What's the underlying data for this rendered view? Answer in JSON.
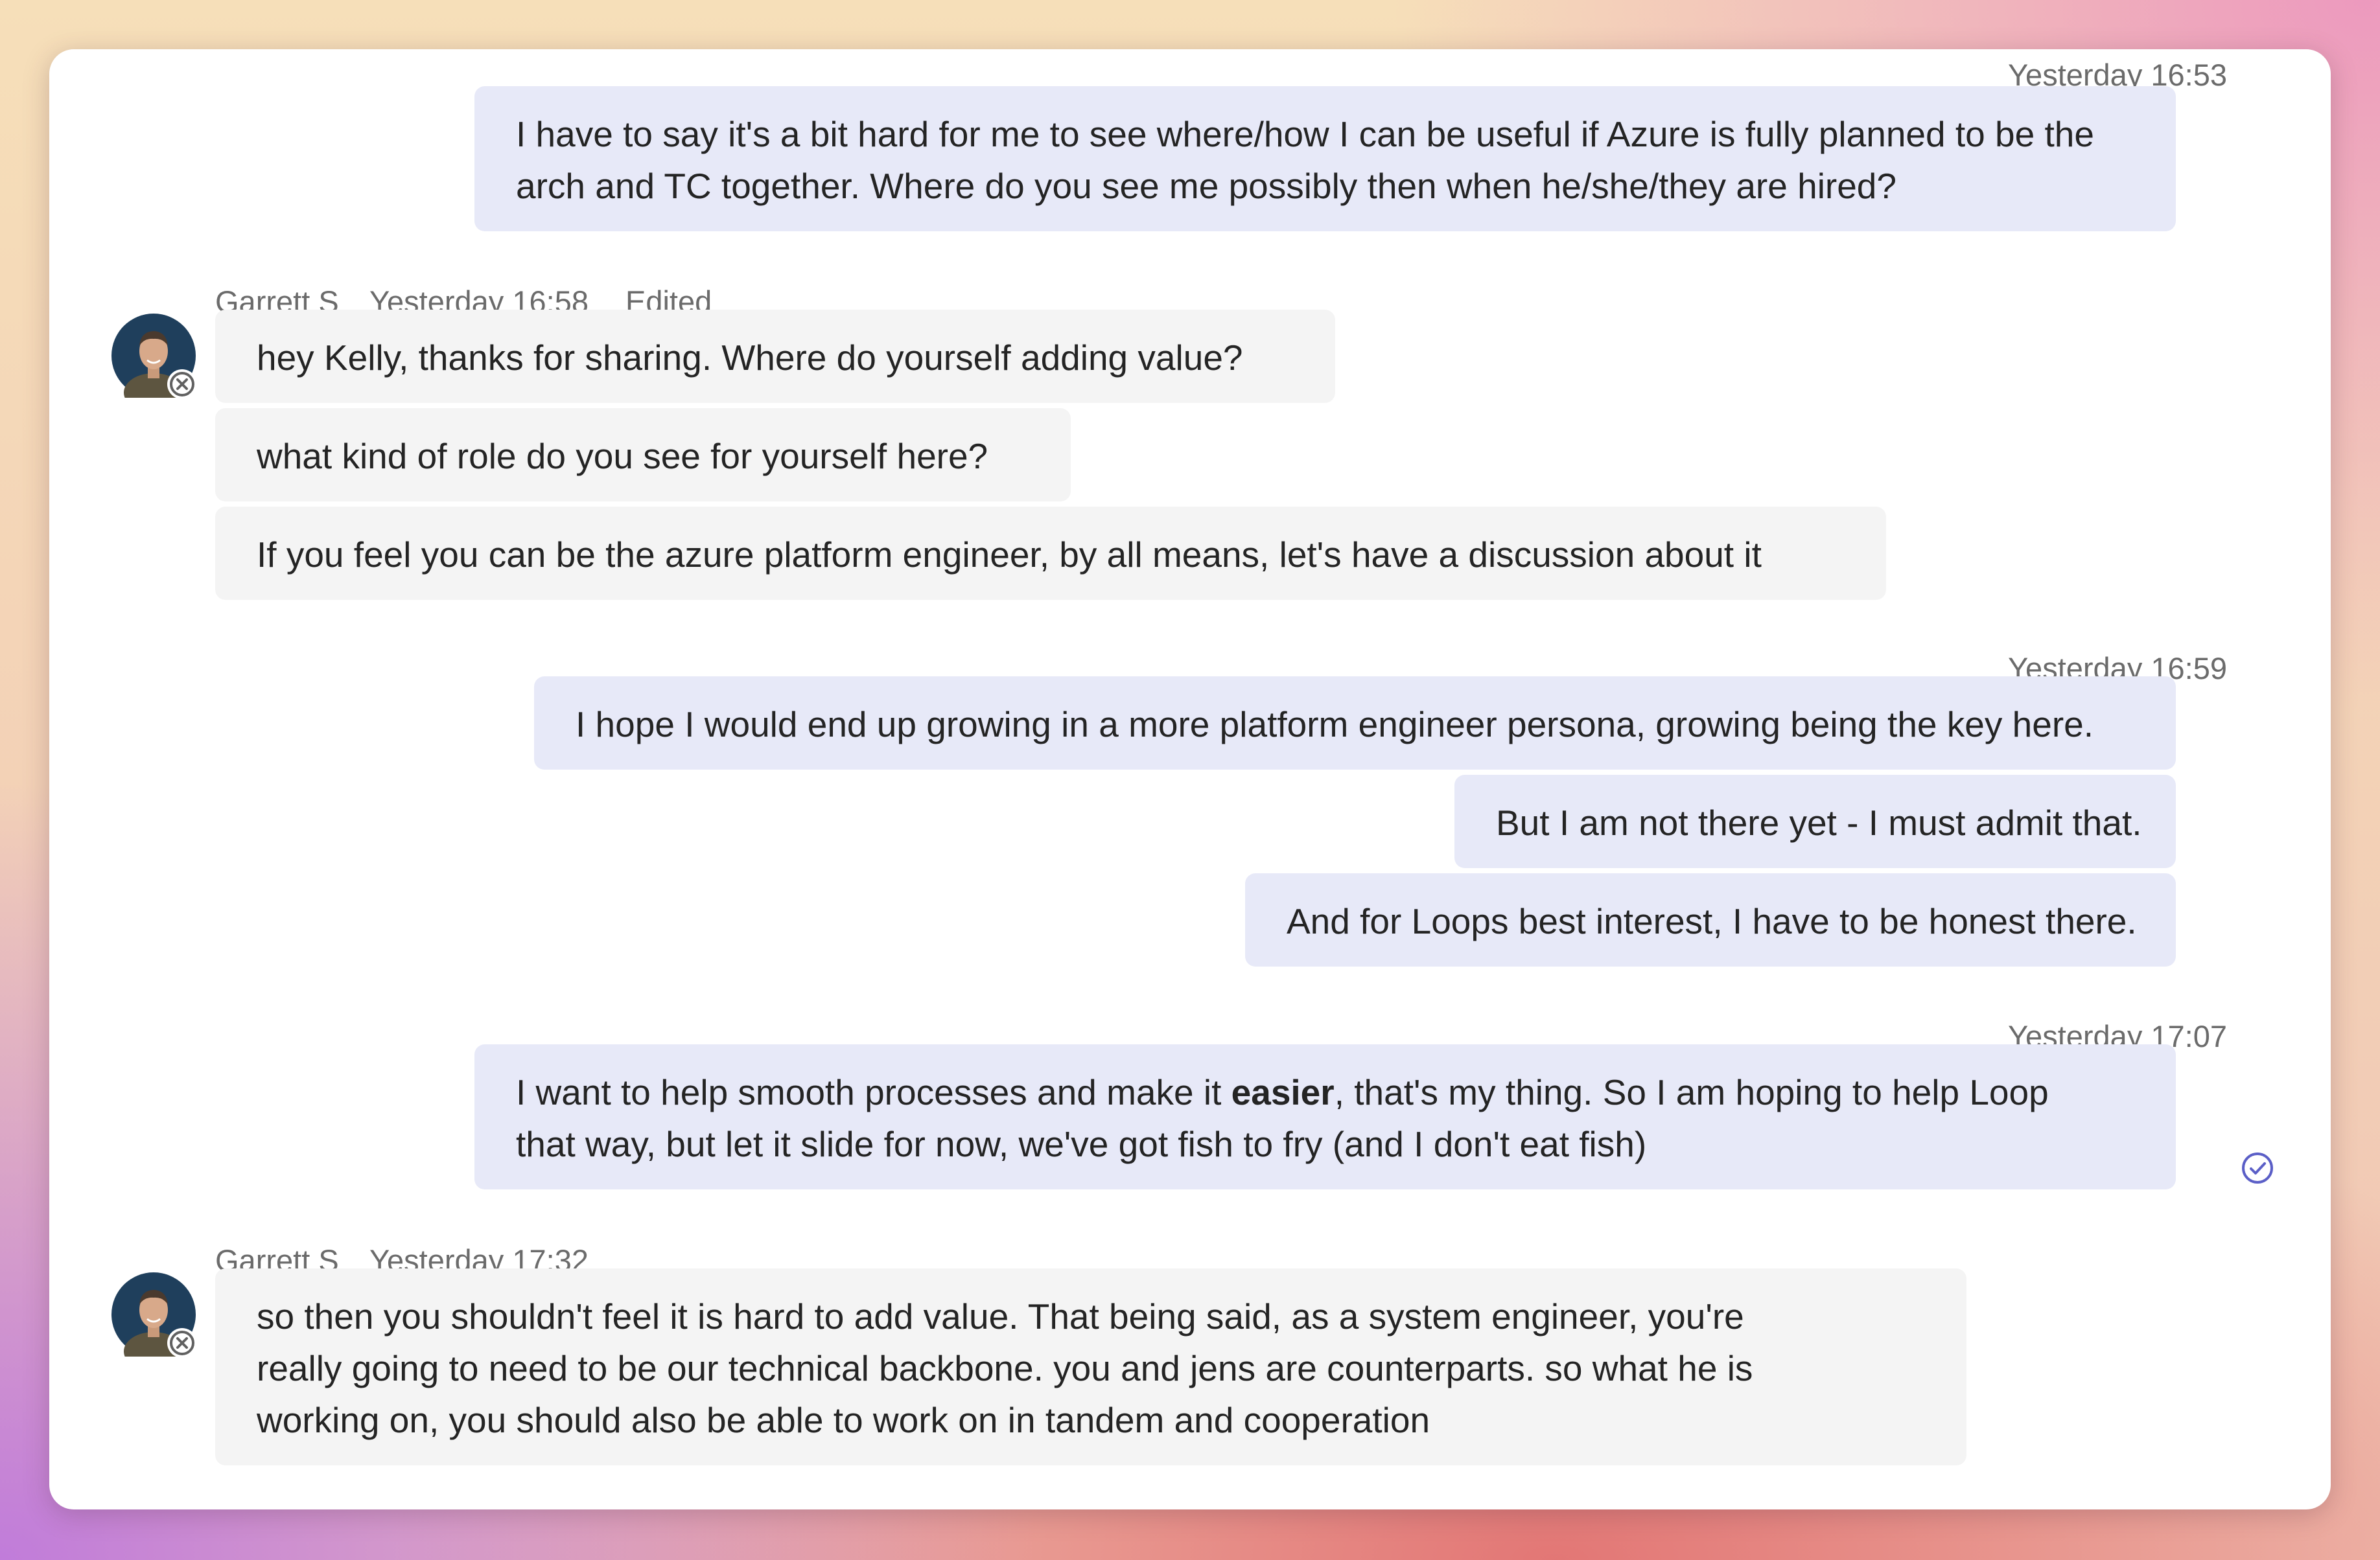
{
  "messages": [
    {
      "direction": "outgoing",
      "timestamp": "Yesterday 16:53",
      "bubbles": [
        "I have to say it's a bit hard for me to see where/how I can be useful if Azure is fully planned to be the arch and TC together. Where do you see me possibly then when he/she/they are hired?"
      ],
      "lines": [
        "I have to say it's a bit hard for me to see where/how I can be useful if Azure is fully planned to be the",
        "arch and TC together. Where do you see me possibly then when he/she/they are hired?"
      ]
    },
    {
      "direction": "incoming",
      "sender": "Garrett S",
      "timestamp": "Yesterday 16:58",
      "edited_label": "Edited",
      "bubbles": [
        "hey Kelly, thanks for sharing. Where do yourself adding value?",
        "what kind of role do you see for yourself here?",
        "If you feel you can be the azure platform engineer, by all means, let's have a discussion about it"
      ]
    },
    {
      "direction": "outgoing",
      "timestamp": "Yesterday 16:59",
      "bubbles": [
        "I hope I would end up growing in a more platform engineer persona, growing being the key here.",
        "But I am not there yet - I must admit that.",
        "And for Loops best interest, I have to be honest there."
      ]
    },
    {
      "direction": "outgoing",
      "timestamp": "Yesterday 17:07",
      "line1_before_bold": "I want to help smooth processes and make it ",
      "line1_bold": "easier",
      "line1_after_bold": ", that's my thing. So I am hoping to help Loop",
      "line2": "that way, but let it slide for now, we've got fish to fry (and I don't eat fish)",
      "read_receipt_icon": "read-receipt-check-icon"
    },
    {
      "direction": "incoming",
      "sender": "Garrett S",
      "timestamp": "Yesterday 17:32",
      "lines": [
        "so then you shouldn't feel it is hard to add value. That being said, as a system engineer, you're",
        "really going to need to be our technical backbone. you and jens are counterparts. so what he is",
        "working on, you should also be able to work on in tandem and cooperation"
      ]
    }
  ],
  "colors": {
    "outgoing_bubble": "#e7e9f8",
    "incoming_bubble": "#f4f4f4",
    "meta_text": "#6b6b6b",
    "message_text": "#242424",
    "read_receipt": "#5b5fc7"
  }
}
